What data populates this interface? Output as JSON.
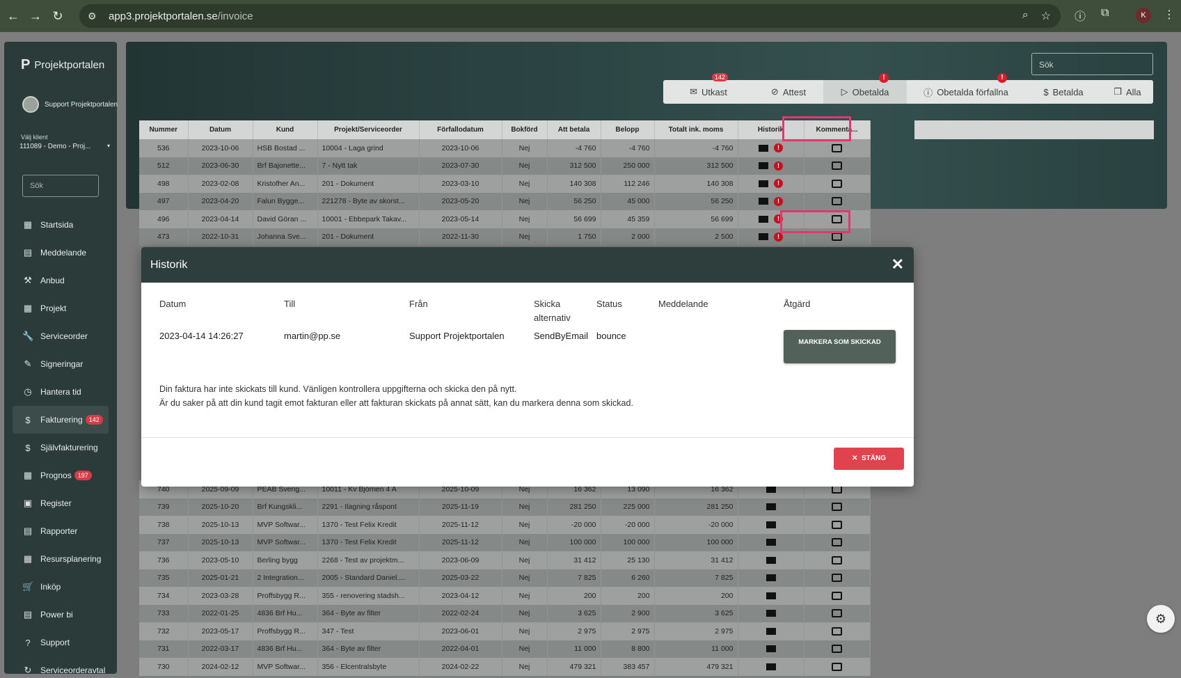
{
  "browser": {
    "url_host": "app3.projektportalen.se",
    "url_path": "/invoice",
    "profile_letter": "K"
  },
  "sidebar": {
    "brand": "Projektportalen",
    "user_name": "Support Projektportalen",
    "client_label": "Välj klient",
    "client_value": "111089 - Demo - Proj...",
    "search_placeholder": "Sök",
    "items": [
      {
        "label": "Startsida",
        "icon": "▦"
      },
      {
        "label": "Meddelande",
        "icon": "▤"
      },
      {
        "label": "Anbud",
        "icon": "⚒"
      },
      {
        "label": "Projekt",
        "icon": "▦"
      },
      {
        "label": "Serviceorder",
        "icon": "🔧"
      },
      {
        "label": "Signeringar",
        "icon": "✎"
      },
      {
        "label": "Hantera tid",
        "icon": "◷"
      },
      {
        "label": "Fakturering",
        "icon": "$",
        "badge": "142"
      },
      {
        "label": "Självfakturering",
        "icon": "$"
      },
      {
        "label": "Prognos",
        "icon": "▦",
        "badge": "197"
      },
      {
        "label": "Register",
        "icon": "▣"
      },
      {
        "label": "Rapporter",
        "icon": "▤"
      },
      {
        "label": "Resursplanering",
        "icon": "▦"
      },
      {
        "label": "Inköp",
        "icon": "🛒"
      },
      {
        "label": "Power bi",
        "icon": "▤"
      },
      {
        "label": "Support",
        "icon": "?"
      },
      {
        "label": "Serviceorderavtal",
        "icon": "↻"
      }
    ]
  },
  "header": {
    "search_placeholder": "Sök",
    "tabs": [
      {
        "label": "Utkast",
        "icon": "✉",
        "badge": "142"
      },
      {
        "label": "Attest",
        "icon": "⊘"
      },
      {
        "label": "Obetalda",
        "icon": "▷",
        "alert": "!"
      },
      {
        "label": "Obetalda förfallna",
        "icon": "ⓘ",
        "alert": "!"
      },
      {
        "label": "Betalda",
        "icon": "$"
      },
      {
        "label": "Alla",
        "icon": "❐"
      }
    ]
  },
  "table": {
    "columns": [
      "Nummer",
      "Datum",
      "Kund",
      "Projekt/Serviceorder",
      "Förfallodatum",
      "Bokförd",
      "Att betala",
      "Belopp",
      "Totalt ink. moms",
      "Historik",
      "Kommenta..."
    ],
    "rows_top": [
      [
        "536",
        "2023-10-06",
        "HSB Bostad ...",
        "10004 - Laga grind",
        "2023-10-06",
        "Nej",
        "-4 760",
        "-4 760",
        "-4 760"
      ],
      [
        "512",
        "2023-06-30",
        "Brf Bajonette...",
        "7 - Nytt tak",
        "2023-07-30",
        "Nej",
        "312 500",
        "250 000",
        "312 500"
      ],
      [
        "498",
        "2023-02-08",
        "Kristofher An...",
        "201 - Dokument",
        "2023-03-10",
        "Nej",
        "140 308",
        "112 246",
        "140 308"
      ],
      [
        "497",
        "2023-04-20",
        "Falun Bygge...",
        "221278 - Byte av skorst...",
        "2023-05-20",
        "Nej",
        "56 250",
        "45 000",
        "56 250"
      ],
      [
        "496",
        "2023-04-14",
        "David Göran ...",
        "10001 - Ebbepark Takav...",
        "2023-05-14",
        "Nej",
        "56 699",
        "45 359",
        "56 699"
      ],
      [
        "473",
        "2022-10-31",
        "Johanna Sve...",
        "201 - Dokument",
        "2022-11-30",
        "Nej",
        "1 750",
        "2 000",
        "2 500"
      ]
    ],
    "rows_bottom": [
      [
        "740",
        "2025-09-09",
        "PEAB Sverig...",
        "10011 - Kv Björnen 4 A",
        "2025-10-09",
        "Nej",
        "16 362",
        "13 090",
        "16 362"
      ],
      [
        "739",
        "2025-10-20",
        "Brf Kungskli...",
        "2291 - Ilagning råspont",
        "2025-11-19",
        "Nej",
        "281 250",
        "225 000",
        "281 250"
      ],
      [
        "738",
        "2025-10-13",
        "MVP Softwar...",
        "1370 - Test Felix Kredit",
        "2025-11-12",
        "Nej",
        "-20 000",
        "-20 000",
        "-20 000"
      ],
      [
        "737",
        "2025-10-13",
        "MVP Softwar...",
        "1370 - Test Felix Kredit",
        "2025-11-12",
        "Nej",
        "100 000",
        "100 000",
        "100 000"
      ],
      [
        "736",
        "2023-05-10",
        "Berling bygg",
        "2268 - Test av projektm...",
        "2023-06-09",
        "Nej",
        "31 412",
        "25 130",
        "31 412"
      ],
      [
        "735",
        "2025-01-21",
        "2 Integration...",
        "2005 - Standard Daniel....",
        "2025-03-22",
        "Nej",
        "7 825",
        "6 260",
        "7 825"
      ],
      [
        "734",
        "2023-03-28",
        "Proffsbygg R...",
        "355 - renovering stadsh...",
        "2023-04-12",
        "Nej",
        "200",
        "200",
        "200"
      ],
      [
        "733",
        "2022-01-25",
        "4836 Brf Hu...",
        "364 - Byte av filter",
        "2022-02-24",
        "Nej",
        "3 625",
        "2 900",
        "3 625"
      ],
      [
        "732",
        "2023-05-17",
        "Proffsbygg R...",
        "347 - Test",
        "2023-06-01",
        "Nej",
        "2 975",
        "2 975",
        "2 975"
      ],
      [
        "731",
        "2022-03-17",
        "4836 Brf Hu...",
        "364 - Byte av filter",
        "2022-04-01",
        "Nej",
        "11 000",
        "8 800",
        "11 000"
      ],
      [
        "730",
        "2024-02-12",
        "MVP Softwar...",
        "356 - Elcentralsbyte",
        "2024-02-22",
        "Nej",
        "479 321",
        "383 457",
        "479 321"
      ]
    ]
  },
  "modal": {
    "title": "Historik",
    "col_datum": "Datum",
    "col_till": "Till",
    "col_fran": "Från",
    "col_skicka": "Skicka alternativ",
    "col_status": "Status",
    "col_meddelande": "Meddelande",
    "col_atgard": "Åtgärd",
    "val_datum": "2023-04-14 14:26:27",
    "val_till": "martin@pp.se",
    "val_fran": "Support Projektportalen",
    "val_skicka": "SendByEmail",
    "val_status": "bounce",
    "mark_button": "MARKERA SOM SKICKAD",
    "message_line1": "Din faktura har inte skickats till kund. Vänligen kontrollera uppgifterna och skicka den på nytt.",
    "message_line2": "Är du saker på att din kund tagit emot fakturan eller att fakturan skickats på annat sätt, kan du markera denna som skickad.",
    "close_button": "STÄNG"
  }
}
